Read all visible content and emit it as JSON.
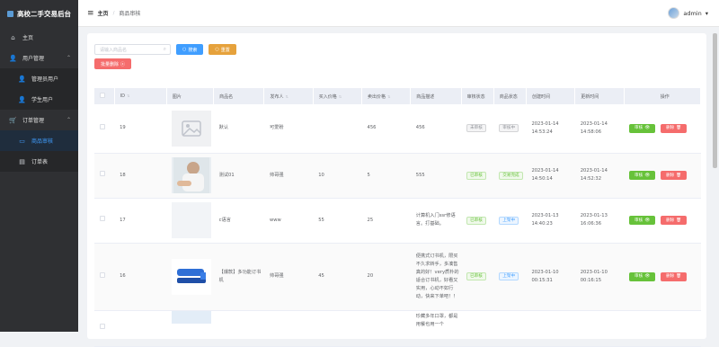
{
  "app": {
    "title": "高校二手交易后台"
  },
  "sidebar": {
    "items": [
      {
        "label": "主页",
        "icon": "home-icon"
      },
      {
        "label": "用户管理",
        "icon": "user-icon"
      },
      {
        "label": "管理员用户",
        "icon": "user-icon"
      },
      {
        "label": "学生用户",
        "icon": "user-icon"
      },
      {
        "label": "订单管理",
        "icon": "cart-icon"
      },
      {
        "label": "商品审核",
        "icon": "laptop-icon"
      },
      {
        "label": "订单表",
        "icon": "order-icon"
      }
    ]
  },
  "header": {
    "home": "主页",
    "sep": "/",
    "current": "商品审核",
    "user": "admin"
  },
  "toolbar": {
    "search_placeholder": "请输入商品名",
    "search_label": "搜索",
    "reset_label": "重置",
    "batch_delete_label": "批量删除"
  },
  "table": {
    "columns": [
      "ID",
      "图片",
      "商品名",
      "发布人",
      "买入价格",
      "卖出价格",
      "商品描述",
      "审核状态",
      "商品状态",
      "创建时间",
      "更新时间",
      "操作"
    ],
    "rows": [
      {
        "id": "19",
        "name": "默认",
        "publisher": "可爱盼",
        "buy": "",
        "sell": "456",
        "desc": "456",
        "audit": "未审核",
        "status": "审核中",
        "created": "2023-01-14 14:53:24",
        "updated": "2023-01-14 14:58:06"
      },
      {
        "id": "18",
        "name": "测试01",
        "publisher": "帅哥强",
        "buy": "10",
        "sell": "5",
        "desc": "555",
        "audit": "已审核",
        "status": "交易完成",
        "created": "2023-01-14 14:50:14",
        "updated": "2023-01-14 14:52:32"
      },
      {
        "id": "17",
        "name": "c语言",
        "publisher": "www",
        "buy": "55",
        "sell": "25",
        "desc": "计算机入门ssr修语言。打基础。",
        "audit": "已审核",
        "status": "上架中",
        "created": "2023-01-13 14:40:23",
        "updated": "2023-01-13 16:06:36"
      },
      {
        "id": "16",
        "name": "【爆款】多功能订书机",
        "publisher": "帅哥强",
        "buy": "45",
        "sell": "20",
        "desc": "便携式订书机，限买不久求转手，多凑售真的好！very质朴的适合订书机，好看又实用，心动不如行动，快来下单吧！！",
        "audit": "已审核",
        "status": "上架中",
        "created": "2023-01-10 00:15:31",
        "updated": "2023-01-10 00:16:15"
      },
      {
        "id": "",
        "name": "",
        "publisher": "",
        "buy": "",
        "sell": "",
        "desc": "珍藏多年口罩，都是用餐也用一个",
        "audit": "",
        "status": "",
        "created": "",
        "updated": ""
      }
    ],
    "audit_btn": "审核",
    "delete_btn": "删除"
  },
  "colors": {
    "sidebar": "#2f3033",
    "primary": "#409eff",
    "warning": "#e6a23c",
    "danger": "#f56c6c",
    "success": "#67c23a"
  }
}
